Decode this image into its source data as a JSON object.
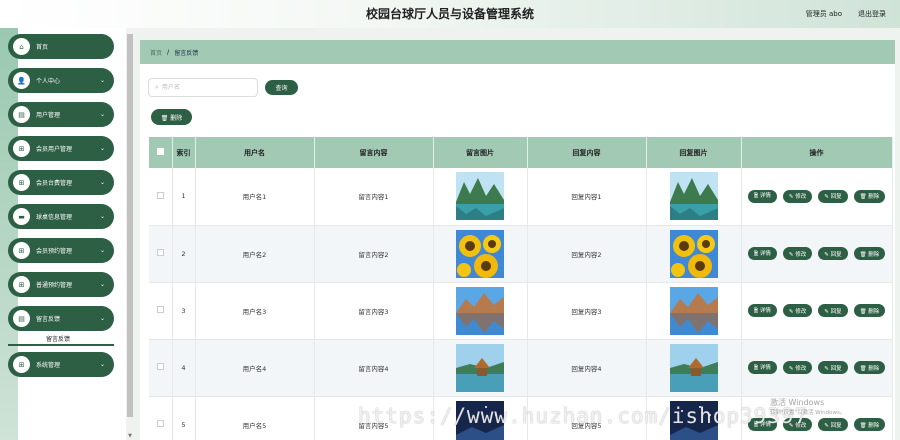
{
  "header": {
    "title": "校园台球厅人员与设备管理系统",
    "user": "管理员 abo",
    "logout": "退出登录"
  },
  "sidebar": {
    "items": [
      {
        "label": "首页",
        "icon": "home-icon",
        "glyph": "⌂",
        "chevron": false
      },
      {
        "label": "个人中心",
        "icon": "user-icon",
        "glyph": "👤",
        "chevron": true
      },
      {
        "label": "用户管理",
        "icon": "file-icon",
        "glyph": "▤",
        "chevron": true
      },
      {
        "label": "会员用户管理",
        "icon": "grid-icon",
        "glyph": "⊞",
        "chevron": true
      },
      {
        "label": "会员台费管理",
        "icon": "grid-icon",
        "glyph": "⊞",
        "chevron": true
      },
      {
        "label": "球桌信息管理",
        "icon": "card-icon",
        "glyph": "▬",
        "chevron": true
      },
      {
        "label": "会员预约管理",
        "icon": "grid-icon",
        "glyph": "⊞",
        "chevron": true
      },
      {
        "label": "普通预约管理",
        "icon": "grid-icon",
        "glyph": "⊞",
        "chevron": true
      },
      {
        "label": "留言反馈",
        "icon": "file-icon",
        "glyph": "▤",
        "chevron": true
      },
      {
        "label": "系统管理",
        "icon": "grid-icon",
        "glyph": "⊞",
        "chevron": true
      }
    ],
    "submenu_label": "留言反馈"
  },
  "breadcrumb": {
    "home": "首页",
    "separator": "/",
    "current": "留言反馈"
  },
  "search": {
    "placeholder": "用户名",
    "query_label": "查询"
  },
  "toolbar": {
    "delete_label": "🗑 删除"
  },
  "table": {
    "headers": [
      "",
      "索引",
      "用户名",
      "留言内容",
      "留言图片",
      "回复内容",
      "回复图片",
      "操作"
    ],
    "op_labels": {
      "detail": "🗎 详情",
      "edit": "✎ 修改",
      "reply": "✎ 回复",
      "delete": "🗑 删除"
    },
    "rows": [
      {
        "index": "1",
        "username": "用户名1",
        "message": "留言内容1",
        "message_image": "lake-image",
        "reply": "回复内容1",
        "reply_image": "lake-image"
      },
      {
        "index": "2",
        "username": "用户名2",
        "message": "留言内容2",
        "message_image": "sunflower-image",
        "reply": "回复内容2",
        "reply_image": "sunflower-image"
      },
      {
        "index": "3",
        "username": "用户名3",
        "message": "留言内容3",
        "message_image": "mountain-image",
        "reply": "回复内容3",
        "reply_image": "mountain-image"
      },
      {
        "index": "4",
        "username": "用户名4",
        "message": "留言内容4",
        "message_image": "pavilion-image",
        "reply": "回复内容4",
        "reply_image": "pavilion-image"
      },
      {
        "index": "5",
        "username": "用户名5",
        "message": "留言内容5",
        "message_image": "night-image",
        "reply": "回复内容5",
        "reply_image": "night-image"
      }
    ]
  },
  "watermark": "https://www.huzhan.com/ishop39397",
  "activate": {
    "line1": "激活 Windows",
    "line2": "转到\"设置\"以激活 Windows。"
  },
  "colors": {
    "primary": "#2d5f45",
    "header_row": "#a2c9b4",
    "alt_row": "#f3f6f9"
  }
}
